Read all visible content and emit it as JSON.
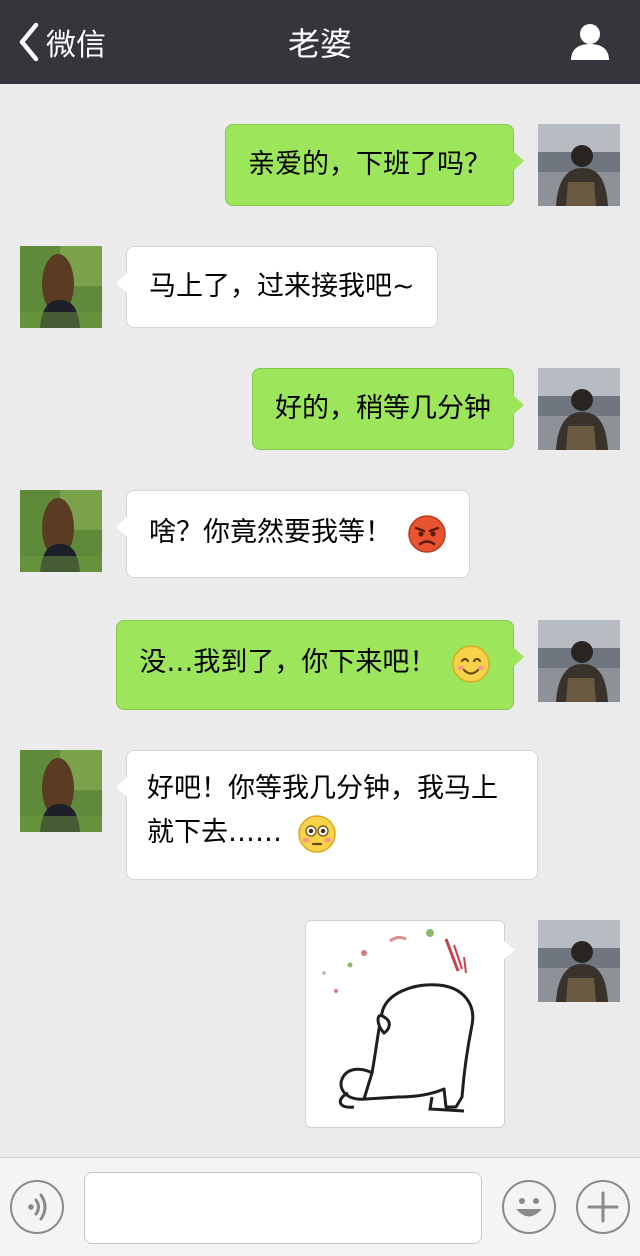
{
  "header": {
    "back_label": "微信",
    "title": "老婆"
  },
  "messages": [
    {
      "from": "me",
      "text": "亲爱的，下班了吗？"
    },
    {
      "from": "contact",
      "text": "马上了，过来接我吧~"
    },
    {
      "from": "me",
      "text": "好的，稍等几分钟"
    },
    {
      "from": "contact",
      "text": "啥？你竟然要我等！",
      "emoji": "angry-face"
    },
    {
      "from": "me",
      "text": "没…我到了，你下来吧！",
      "emoji": "smiling-face"
    },
    {
      "from": "contact",
      "text": "好吧！你等我几分钟，我马上就下去……",
      "emoji": "flushed-face"
    },
    {
      "from": "me",
      "type": "sticker",
      "sticker": "cartoon-rabbit-bowing-sticker"
    }
  ],
  "input": {
    "placeholder": ""
  },
  "colors": {
    "topbar": "#35353b",
    "outgoing_bubble": "#9de55a",
    "incoming_bubble": "#ffffff",
    "chat_background": "#ebebeb"
  }
}
